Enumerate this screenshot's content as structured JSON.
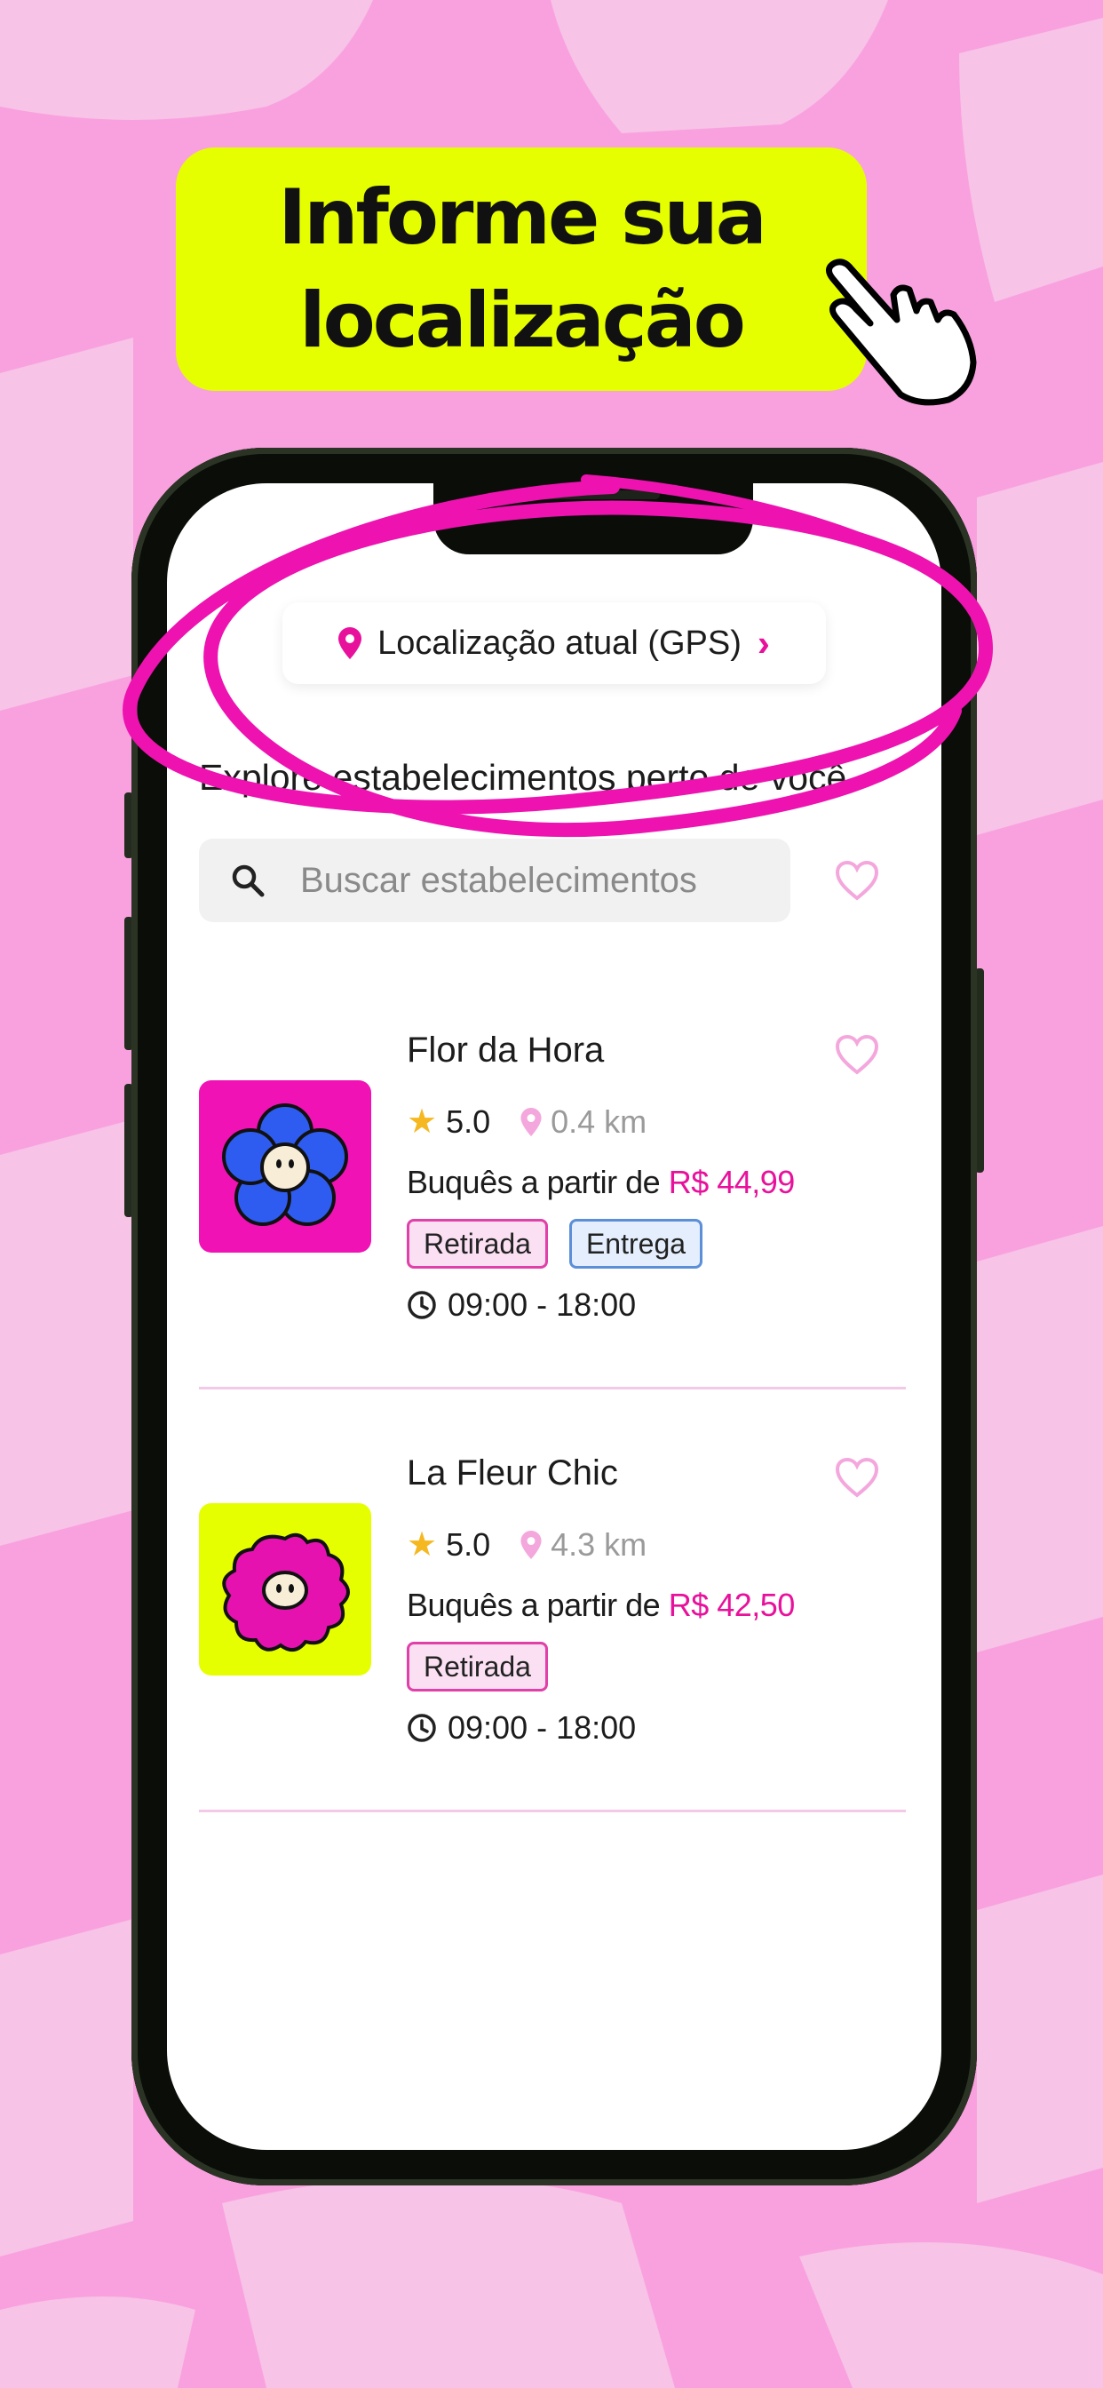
{
  "banner": {
    "title": "Informe sua localização"
  },
  "location": {
    "label": "Localização atual (GPS)",
    "chevron": "›"
  },
  "explore": {
    "heading": "Explore estabelecimentos perto de você"
  },
  "search": {
    "placeholder": "Buscar estabelecimentos"
  },
  "stores": [
    {
      "name": "Flor da Hora",
      "rating": "5.0",
      "distance": "0.4 km",
      "price_prefix": "Buquês a partir de",
      "price": "R$ 44,99",
      "tags": [
        "Retirada",
        "Entrega"
      ],
      "hours": "09:00 - 18:00",
      "thumb_color": "#f012b4",
      "flower_color": "#2f5cf0"
    },
    {
      "name": "La Fleur Chic",
      "rating": "5.0",
      "distance": "4.3 km",
      "price_prefix": "Buquês a partir de",
      "price": "R$ 42,50",
      "tags": [
        "Retirada"
      ],
      "hours": "09:00 - 18:00",
      "thumb_color": "#e6ff00",
      "flower_color": "#e612b0"
    }
  ],
  "icons": {
    "hand": "pointing-hand-icon",
    "pin": "location-pin-icon",
    "search": "search-icon",
    "heart": "heart-icon",
    "star": "star-icon",
    "clock": "clock-icon"
  },
  "colors": {
    "accent": "#e8119b",
    "banner": "#e6ff00",
    "background": "#f9a6e0"
  }
}
